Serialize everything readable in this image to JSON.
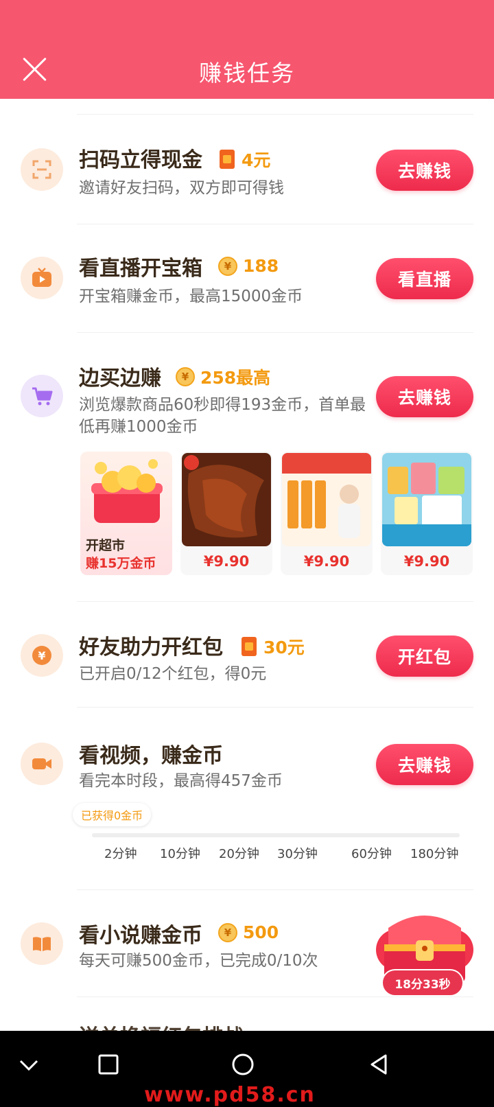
{
  "header": {
    "title": "赚钱任务"
  },
  "tasks": [
    {
      "title": "扫码立得现金",
      "reward": "4元",
      "desc": "邀请好友扫码，双方即可得钱",
      "button": "去赚钱"
    },
    {
      "title": "看直播开宝箱",
      "reward": "188",
      "desc": "开宝箱赚金币，最高15000金币",
      "button": "看直播"
    },
    {
      "title": "边买边赚",
      "reward": "258最高",
      "desc": "浏览爆款商品60秒即得193金币，首单最低再赚1000金币",
      "button": "去赚钱"
    },
    {
      "title": "好友助力开红包",
      "reward": "30元",
      "desc": "已开启0/12个红包，得0元",
      "button": "开红包"
    },
    {
      "title": "看视频，赚金币",
      "desc": "看完本时段，最高得457金币",
      "button": "去赚钱"
    },
    {
      "title": "看小说赚金币",
      "reward": "500",
      "desc": "每天可赚500金币，已完成0/10次",
      "chest_timer": "18分33秒"
    }
  ],
  "products": {
    "market": {
      "line1": "开超市",
      "line2": "赚15万金币"
    },
    "items": [
      {
        "price": "¥9.90",
        "color": "#7a2e12"
      },
      {
        "price": "¥9.90",
        "color": "#f0a33a"
      },
      {
        "price": "¥9.90",
        "color": "#8ad0e8"
      }
    ]
  },
  "video_progress": {
    "badge": "已获得0金币",
    "fraction": 0,
    "ticks": [
      "2分钟",
      "10分钟",
      "20分钟",
      "30分钟",
      "60分钟",
      "180分钟"
    ]
  },
  "partial_next_task": "送兑换福红包排战",
  "watermark": "www.pd58.cn",
  "colors": {
    "header": "#f7566f",
    "button": "#ee2b4c",
    "reward": "#f39a10"
  }
}
